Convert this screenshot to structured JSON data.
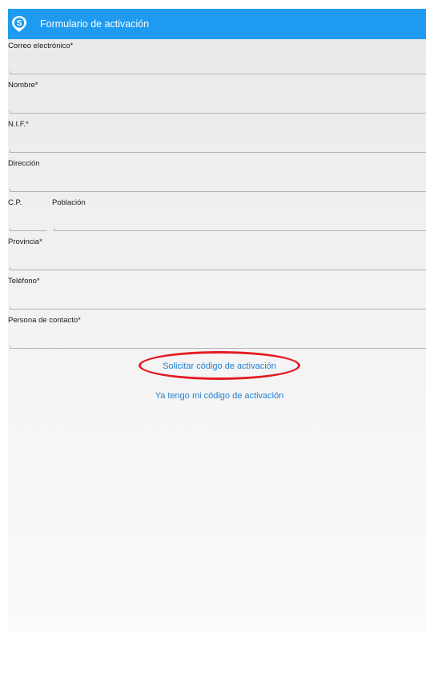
{
  "appbar": {
    "title": "Formulario de activación",
    "logo_icon": "s-pin-logo-icon",
    "color": "#1e9bf0"
  },
  "form": {
    "email": {
      "label": "Correo electrónico*",
      "value": ""
    },
    "name": {
      "label": "Nombre*",
      "value": ""
    },
    "nif": {
      "label": "N.I.F.*",
      "value": ""
    },
    "address": {
      "label": "Dirección",
      "value": ""
    },
    "postal_code": {
      "label": "C.P.",
      "value": ""
    },
    "city": {
      "label": "Población",
      "value": ""
    },
    "province": {
      "label": "Provincia*",
      "value": ""
    },
    "phone": {
      "label": "Teléfono*",
      "value": ""
    },
    "contact": {
      "label": "Persona de contacto*",
      "value": ""
    }
  },
  "actions": {
    "request_code": "Solicitar código de activación",
    "have_code": "Ya tengo mi código de activación"
  },
  "annotation": {
    "highlight_color": "#e31b23",
    "highlight_target": "request-code-link"
  }
}
